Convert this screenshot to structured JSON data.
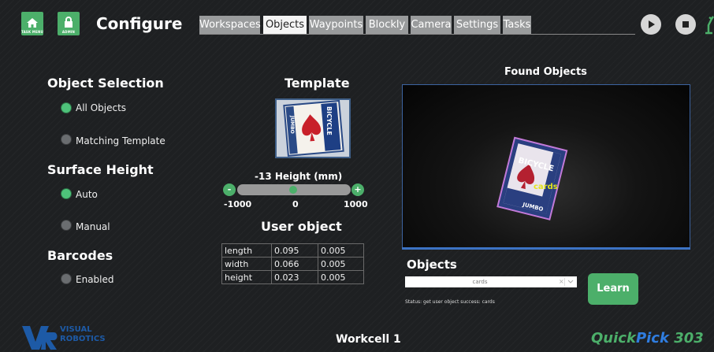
{
  "header": {
    "task_menu_label": "TASK MENU",
    "admin_label": "ADMIN",
    "title": "Configure",
    "tabs": [
      {
        "label": "Workspaces",
        "active": false
      },
      {
        "label": "Objects",
        "active": true
      },
      {
        "label": "Waypoints",
        "active": false
      },
      {
        "label": "Blockly",
        "active": false
      },
      {
        "label": "Camera",
        "active": false
      },
      {
        "label": "Settings",
        "active": false
      },
      {
        "label": "Tasks",
        "active": false
      }
    ]
  },
  "object_selection": {
    "heading": "Object Selection",
    "options": [
      {
        "label": "All Objects",
        "selected": true
      },
      {
        "label": "Matching Template",
        "selected": false
      }
    ]
  },
  "surface_height": {
    "heading": "Surface Height",
    "options": [
      {
        "label": "Auto",
        "selected": true
      },
      {
        "label": "Manual",
        "selected": false
      }
    ]
  },
  "barcodes": {
    "heading": "Barcodes",
    "option": {
      "label": "Enabled",
      "selected": false
    }
  },
  "template": {
    "heading": "Template",
    "card_brand": "BICYCLE",
    "card_sub": "JUMBO"
  },
  "height_slider": {
    "label": "-13 Height (mm)",
    "value": -13,
    "min_label": "-1000",
    "mid_label": "0",
    "max_label": "1000",
    "minus": "-",
    "plus": "+"
  },
  "user_object": {
    "heading": "User object",
    "rows": [
      [
        "length",
        "0.095",
        "0.005"
      ],
      [
        "width",
        "0.066",
        "0.005"
      ],
      [
        "height",
        "0.023",
        "0.005"
      ]
    ]
  },
  "found_objects": {
    "heading": "Found Objects",
    "detection_label": "cards",
    "card_brand": "BICYCLE",
    "card_sub": "JUMBO"
  },
  "objects_panel": {
    "heading": "Objects",
    "selected": "cards",
    "clear_glyph": "×",
    "status": "Status: get user object success: cards",
    "learn_label": "Learn"
  },
  "footer": {
    "logo_word1": "VISUAL",
    "logo_word2": "ROBOTICS",
    "workcell": "Workcell 1",
    "product_a": "Quick",
    "product_b": "Pick",
    "product_c": " 303"
  },
  "colors": {
    "accent_green": "#4caf6a",
    "product_blue": "#2f7de0",
    "logo_blue": "#1d5aa6"
  }
}
